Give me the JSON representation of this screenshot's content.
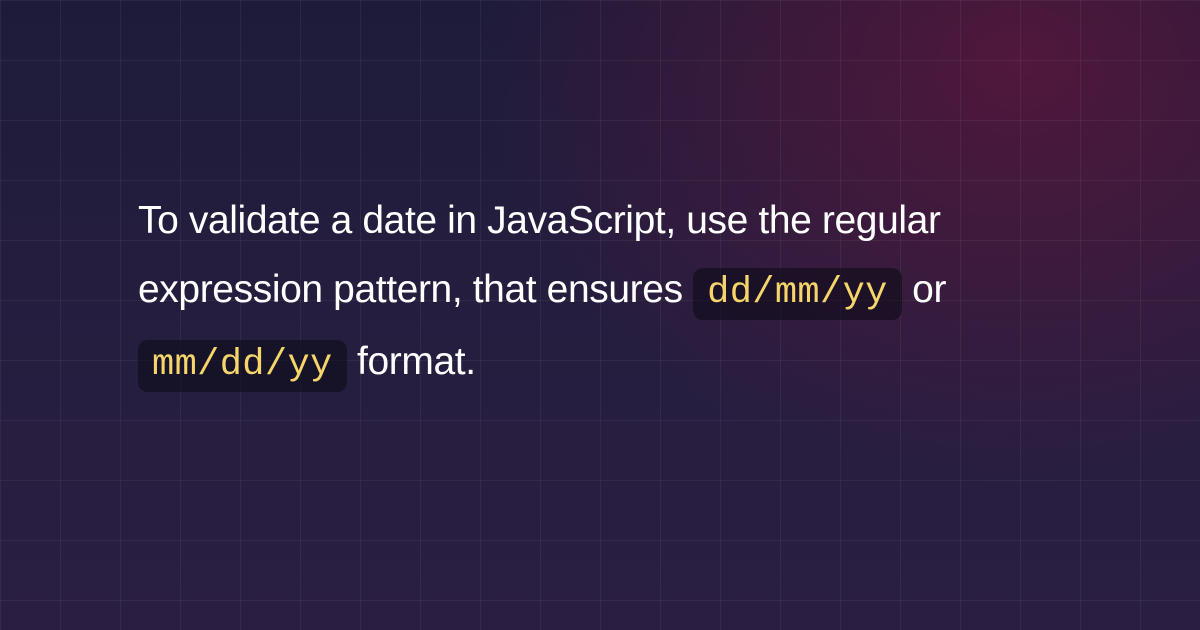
{
  "text": {
    "part1": "To validate a date in JavaScript, use the regular expression pattern, that ensures ",
    "code1": "dd/mm/yy",
    "sep": " or ",
    "code2": "mm/dd/yy",
    "part2": " format."
  }
}
